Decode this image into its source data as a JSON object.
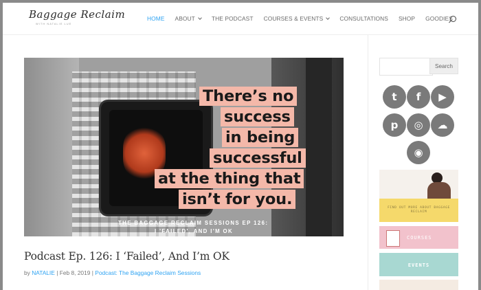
{
  "header": {
    "logo_text": "Baggage Reclaim",
    "logo_sub": "WITH NATALIE LUE",
    "nav": [
      {
        "label": "HOME",
        "has_dropdown": false,
        "active": true
      },
      {
        "label": "ABOUT",
        "has_dropdown": true,
        "active": false
      },
      {
        "label": "THE PODCAST",
        "has_dropdown": false,
        "active": false
      },
      {
        "label": "COURSES & EVENTS",
        "has_dropdown": true,
        "active": false
      },
      {
        "label": "CONSULTATIONS",
        "has_dropdown": false,
        "active": false
      },
      {
        "label": "SHOP",
        "has_dropdown": false,
        "active": false
      },
      {
        "label": "GOODIES",
        "has_dropdown": false,
        "active": false
      }
    ],
    "search_icon": "search-icon"
  },
  "post": {
    "image": {
      "quote_lines": [
        "There’s no",
        "success",
        "in being",
        "successful",
        "at the thing that",
        "isn’t for you."
      ],
      "episode_line1": "THE BAGGAGE RECLAIM SESSIONS EP 126:",
      "episode_line2": "I 'FAILED', AND I'M OK"
    },
    "title": "Podcast Ep. 126: I ‘Failed’, And I’m OK",
    "meta": {
      "by": "by",
      "author": "NATALIE",
      "sep1": "|",
      "date": "Feb 8, 2019",
      "sep2": "|",
      "category": "Podcast: The Baggage Reclaim Sessions"
    }
  },
  "sidebar": {
    "search": {
      "placeholder": "",
      "button": "Search"
    },
    "social": [
      {
        "name": "twitter-icon",
        "glyph": "t"
      },
      {
        "name": "facebook-icon",
        "glyph": "f"
      },
      {
        "name": "youtube-icon",
        "glyph": "▶"
      },
      {
        "name": "pinterest-icon",
        "glyph": "p"
      },
      {
        "name": "instagram-icon",
        "glyph": "◎"
      },
      {
        "name": "soundcloud-icon",
        "glyph": "☁"
      },
      {
        "name": "podcast-icon",
        "glyph": "◉"
      }
    ],
    "banners": {
      "about_text": "FIND OUT MORE ABOUT BAGGAGE RECLAIM",
      "courses_text": "COURSES",
      "events_text": "EVENTS"
    },
    "colors": {
      "social_bg": "#7a7a7a",
      "courses": "#f2c2cc",
      "events": "#a8d8d2",
      "about_strip": "#f5d96b"
    }
  },
  "colors": {
    "accent": "#2ea3f2",
    "quote_highlight": "#f4b8a9"
  }
}
